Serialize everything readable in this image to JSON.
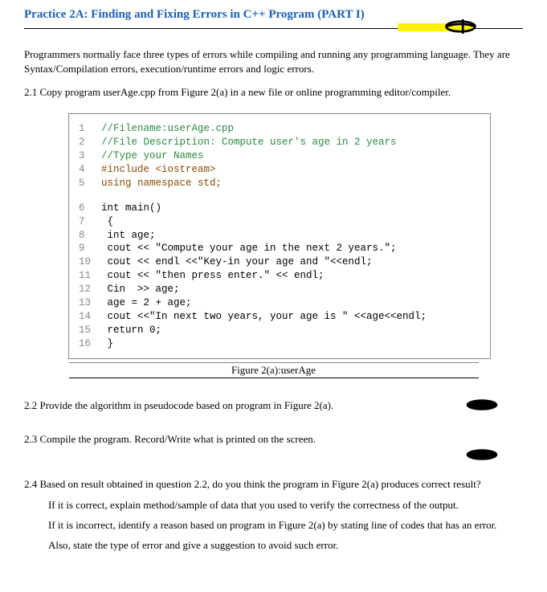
{
  "title": "Practice 2A: Finding and Fixing Errors in C++ Program (PART I)",
  "intro_para": "Programmers normally face three types of errors while compiling and running any programming language. They are Syntax/Compilation errors, execution/runtime errors and logic errors.",
  "item_2_1": "2.1 Copy program userAge.cpp from Figure 2(a) in a new file or online programming editor/compiler.",
  "code_lines": {
    "l1": "//Filename:userAge.cpp",
    "l2": "//File Description: Compute user's age in 2 years",
    "l3": "//Type your Names",
    "l4": "#include <iostream>",
    "l5": "using namespace std;",
    "l6": "int main()",
    "l7": " {",
    "l8": " int age;",
    "l9": " cout << \"Compute your age in the next 2 years.\";",
    "l10": " cout << endl <<\"Key-in your age and \"<<endl;",
    "l11": " cout << \"then press enter.\" << endl;",
    "l12": " Cin  >> age;",
    "l13": " age = 2 + age;",
    "l14": " cout <<\"In next two years, your age is \" <<age<<endl;",
    "l15": " return 0;",
    "l16": " }"
  },
  "line_numbers": [
    "1",
    "2",
    "3",
    "4",
    "5",
    "6",
    "7",
    "8",
    "9",
    "10",
    "11",
    "12",
    "13",
    "14",
    "15",
    "16"
  ],
  "caption": "Figure 2(a):userAge",
  "item_2_2": "2.2 Provide the algorithm in pseudocode based on program in Figure 2(a).",
  "item_2_3": "2.3 Compile the program. Record/Write what is printed on the screen.",
  "item_2_4": "2.4 Based on result obtained in question 2.2, do you think the program in Figure 2(a) produces correct result?",
  "item_2_4_a": "If it is correct, explain method/sample of data that you used to verify the correctness of the output.",
  "item_2_4_b": "If it is incorrect, identify a reason based on program in Figure 2(a) by stating line of codes that has an error.",
  "item_2_4_c": "Also, state the type of error and give a suggestion to avoid such error."
}
